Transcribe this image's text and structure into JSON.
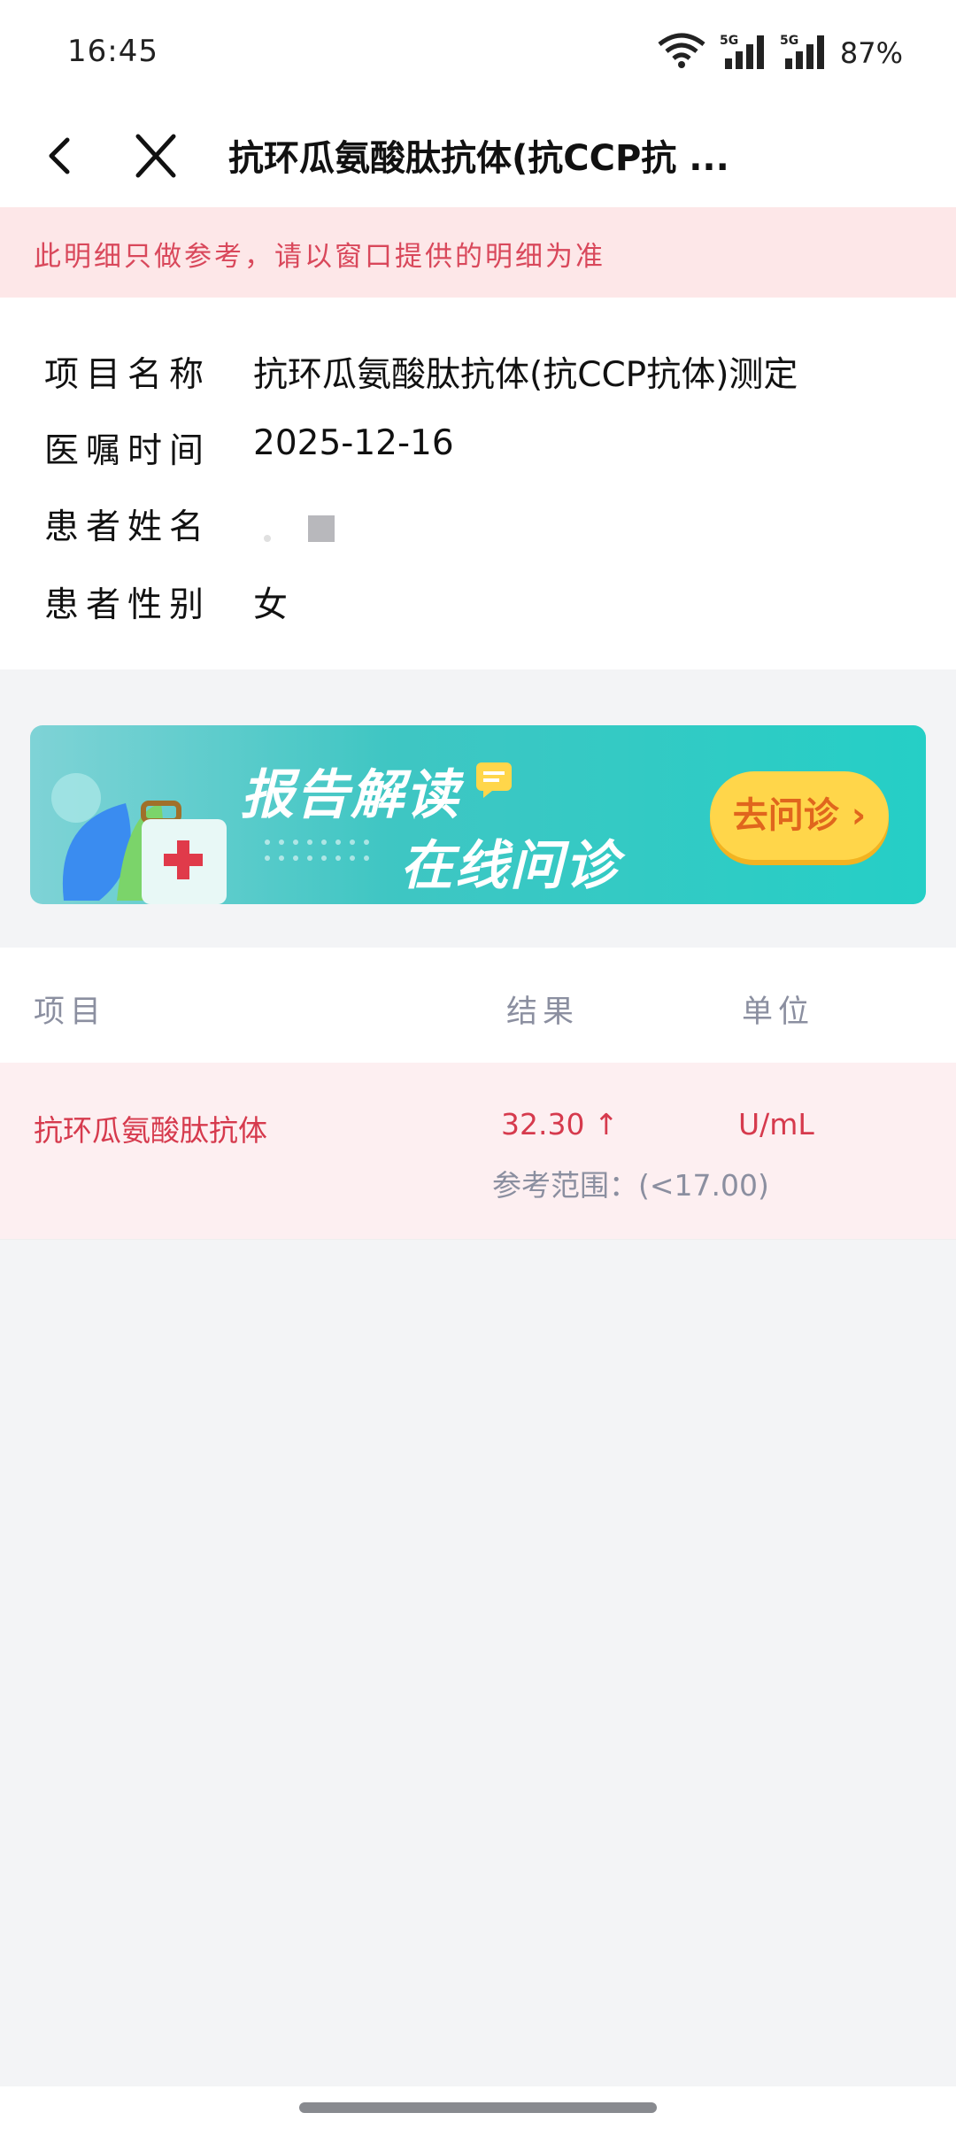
{
  "status_bar": {
    "time": "16:45",
    "signal1_label": "5G",
    "signal2_label": "5G",
    "battery": "87%"
  },
  "nav": {
    "back_icon": "back-chevron-icon",
    "close_icon": "close-icon",
    "title": "抗环瓜氨酸肽抗体(抗CCP抗 ..."
  },
  "notice": {
    "text": "此明细只做参考，请以窗口提供的明细为准"
  },
  "info": {
    "rows": [
      {
        "label": "项目名称",
        "value": "抗环瓜氨酸肽抗体(抗CCP抗体)测定"
      },
      {
        "label": "医嘱时间",
        "value": "2025-12-16"
      },
      {
        "label": "患者姓名",
        "value": ""
      },
      {
        "label": "患者性别",
        "value": "女"
      }
    ]
  },
  "banner": {
    "line1": "报告解读",
    "line2": "在线问诊",
    "button": "去问诊 ›"
  },
  "table": {
    "headers": {
      "item": "项目",
      "result": "结果",
      "unit": "单位"
    },
    "rows": [
      {
        "item": "抗环瓜氨酸肽抗体",
        "result": "32.30",
        "flag": "↑",
        "unit": "U/mL",
        "reference": "参考范围：(<17.00)"
      }
    ]
  },
  "colors": {
    "notice_bg": "#fde7e8",
    "alert_text": "#d63a4d",
    "muted_text": "#8b8fa0",
    "banner_teal": "#25cfc6",
    "button_yellow": "#ffd64a"
  }
}
